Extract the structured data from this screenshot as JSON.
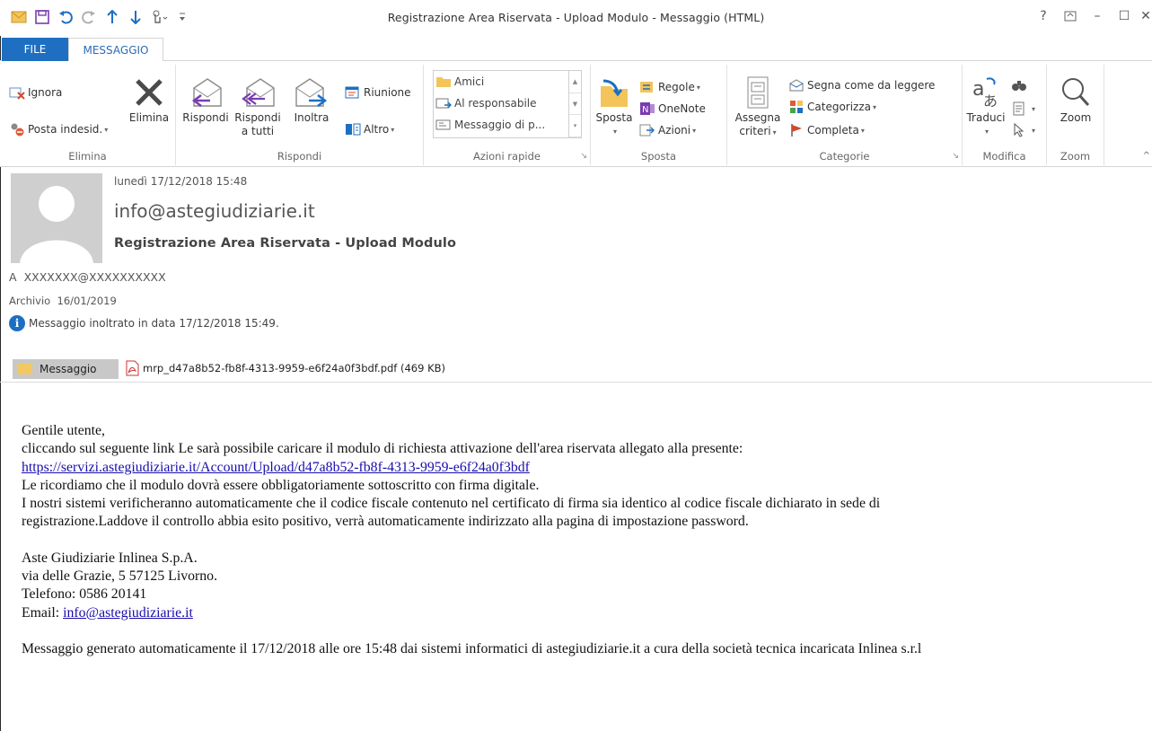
{
  "window": {
    "title": "Registrazione Area Riservata - Upload Modulo - Messaggio (HTML)",
    "help": "?",
    "ribbon_display_icon": "ribbon-display-icon",
    "minimize": "–",
    "restore": "☐",
    "close": "✕"
  },
  "qat": {
    "icons": [
      "mail-icon",
      "save-icon",
      "undo-icon",
      "redo-icon",
      "up-arrow-icon",
      "down-arrow-icon",
      "touch-mode-icon",
      "customize-qat-icon"
    ]
  },
  "tabs": {
    "file": "FILE",
    "message": "MESSAGGIO"
  },
  "ribbon": {
    "elimina": {
      "label": "Elimina",
      "ignore": "Ignora",
      "junk": "Posta indesid.",
      "delete": "Elimina"
    },
    "rispondi": {
      "label": "Rispondi",
      "reply": "Rispondi",
      "reply_all_1": "Rispondi",
      "reply_all_2": "a tutti",
      "forward": "Inoltra",
      "meeting": "Riunione",
      "more": "Altro"
    },
    "azioni_rapide": {
      "label": "Azioni rapide",
      "items": [
        "Amici",
        "Al responsabile",
        "Messaggio di p..."
      ]
    },
    "sposta": {
      "label": "Sposta",
      "move": "Sposta",
      "rules": "Regole",
      "onenote": "OneNote",
      "actions": "Azioni"
    },
    "categorie": {
      "label": "Categorie",
      "assign_1": "Assegna",
      "assign_2": "criteri",
      "mark_read": "Segna come da leggere",
      "categorize": "Categorizza",
      "followup": "Completa"
    },
    "modifica": {
      "label": "Modifica",
      "translate": "Traduci"
    },
    "zoom": {
      "label": "Zoom",
      "zoom": "Zoom"
    }
  },
  "header": {
    "date": "lunedì 17/12/2018 15:48",
    "from": "info@astegiudiziarie.it",
    "subject": "Registrazione Area Riservata - Upload Modulo",
    "to_label": "A",
    "to_value": "XXXXXXX@XXXXXXXXXX",
    "archive_label": "Archivio",
    "archive_date": "16/01/2019",
    "info": "Messaggio inoltrato in data 17/12/2018 15:49."
  },
  "attachments": {
    "message_tab": "Messaggio",
    "file": "mrp_d47a8b52-fb8f-4313-9959-e6f24a0f3bdf.pdf (469 KB)"
  },
  "body": {
    "greeting": "Gentile utente,",
    "line1": "cliccando sul seguente link Le sarà possibile caricare il modulo di richiesta attivazione dell'area riservata allegato alla presente:",
    "link": "https://servizi.astegiudiziarie.it/Account/Upload/d47a8b52-fb8f-4313-9959-e6f24a0f3bdf",
    "line2": "Le ricordiamo che il modulo dovrà essere obbligatoriamente sottoscritto con firma digitale.",
    "line3": "I nostri sistemi verificheranno automaticamente che il codice fiscale contenuto nel certificato di firma sia identico al codice fiscale dichiarato in sede di",
    "line4": "registrazione.Laddove il controllo abbia esito positivo, verrà automaticamente indirizzato alla pagina di impostazione password.",
    "company": "Aste Giudiziarie Inlinea S.p.A.",
    "address": "via delle Grazie, 5 57125 Livorno.",
    "phone": "Telefono: 0586 20141",
    "email_label": "Email:",
    "email": "info@astegiudiziarie.it",
    "footer": "Messaggio generato automaticamente il 17/12/2018 alle ore 15:48 dai sistemi informatici di astegiudiziarie.it a cura della società tecnica incaricata Inlinea s.r.l"
  },
  "colors": {
    "accent": "#1e6fc1",
    "link": "#1a0dab",
    "avatar": "#cfcfcf"
  }
}
